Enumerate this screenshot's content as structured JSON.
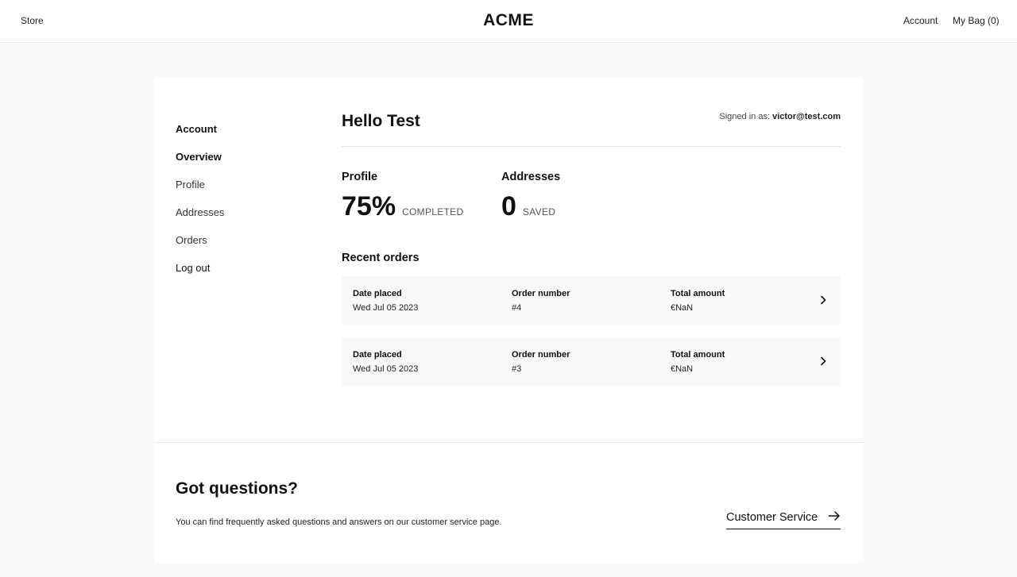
{
  "nav": {
    "store": "Store",
    "brand": "ACME",
    "account": "Account",
    "bag": "My Bag (0)"
  },
  "sidebar": {
    "heading": "Account",
    "items": [
      {
        "label": "Overview",
        "active": true
      },
      {
        "label": "Profile"
      },
      {
        "label": "Addresses"
      },
      {
        "label": "Orders"
      },
      {
        "label": "Log out"
      }
    ]
  },
  "overview": {
    "greeting": "Hello Test",
    "signed_in_label": "Signed in as:",
    "email": "victor@test.com",
    "profile": {
      "label": "Profile",
      "value": "75%",
      "suffix": "COMPLETED"
    },
    "addresses": {
      "label": "Addresses",
      "value": "0",
      "suffix": "SAVED"
    },
    "recent_orders_title": "Recent orders",
    "orders": [
      {
        "date_label": "Date placed",
        "date": "Wed Jul 05 2023",
        "number_label": "Order number",
        "number": "#4",
        "total_label": "Total amount",
        "total": "€NaN"
      },
      {
        "date_label": "Date placed",
        "date": "Wed Jul 05 2023",
        "number_label": "Order number",
        "number": "#3",
        "total_label": "Total amount",
        "total": "€NaN"
      }
    ]
  },
  "help": {
    "title": "Got questions?",
    "description": "You can find frequently asked questions and answers on our customer service page.",
    "link_label": "Customer Service"
  },
  "icons": {
    "order_chevron": "chevron-right-icon",
    "service_arrow": "arrow-right-icon"
  }
}
